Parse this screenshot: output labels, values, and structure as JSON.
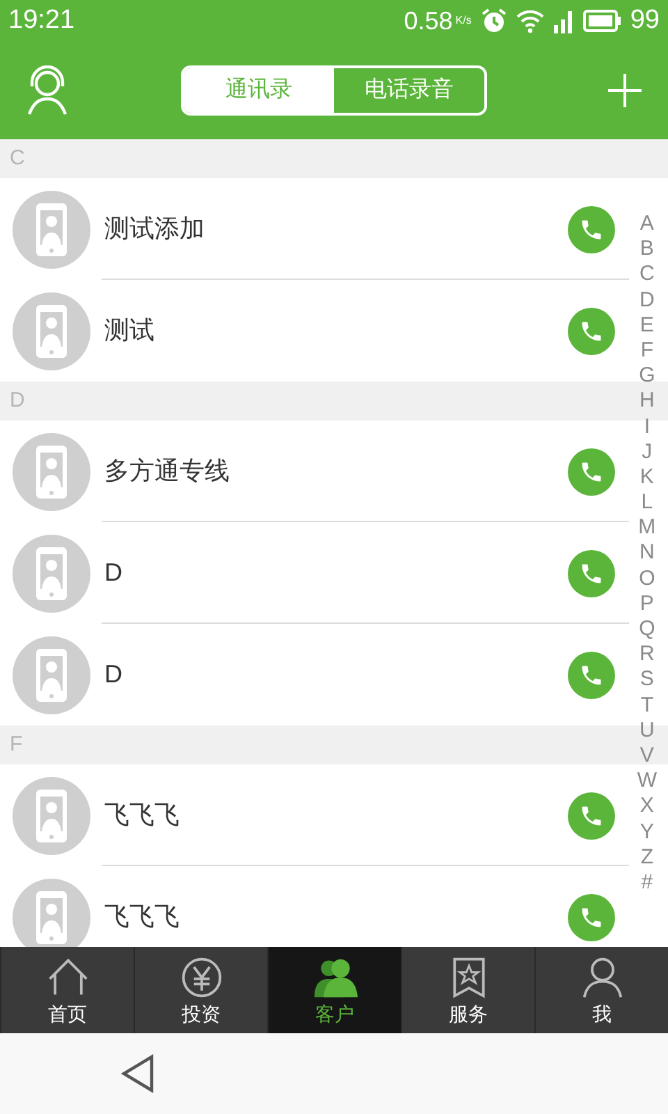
{
  "status_bar": {
    "time": "19:21",
    "speed": "0.58",
    "speed_unit": "K/s",
    "battery": "99"
  },
  "header": {
    "tabs": [
      {
        "label": "通讯录",
        "selected": true
      },
      {
        "label": "电话录音",
        "selected": false
      }
    ]
  },
  "sections": [
    {
      "letter": "C",
      "contacts": [
        {
          "name": "测试添加"
        },
        {
          "name": "测试"
        }
      ]
    },
    {
      "letter": "D",
      "contacts": [
        {
          "name": "多方通专线"
        },
        {
          "name": "D"
        },
        {
          "name": "D"
        }
      ]
    },
    {
      "letter": "F",
      "contacts": [
        {
          "name": "飞飞飞"
        },
        {
          "name": "飞飞飞"
        }
      ]
    }
  ],
  "index_letters": [
    "A",
    "B",
    "C",
    "D",
    "E",
    "F",
    "G",
    "H",
    "I",
    "J",
    "K",
    "L",
    "M",
    "N",
    "O",
    "P",
    "Q",
    "R",
    "S",
    "T",
    "U",
    "V",
    "W",
    "X",
    "Y",
    "Z",
    "#"
  ],
  "bottom_nav": [
    {
      "label": "首页",
      "kind": "home",
      "selected": false
    },
    {
      "label": "投资",
      "kind": "yen",
      "selected": false
    },
    {
      "label": "客户",
      "kind": "people",
      "selected": true
    },
    {
      "label": "服务",
      "kind": "star",
      "selected": false
    },
    {
      "label": "我",
      "kind": "person",
      "selected": false
    }
  ]
}
